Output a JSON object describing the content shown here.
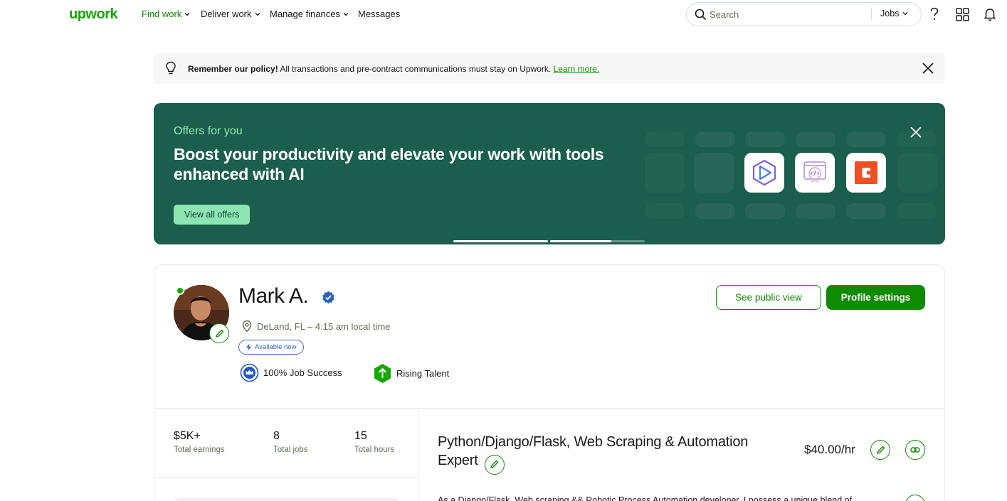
{
  "nav": {
    "logo": "upwork",
    "items": [
      {
        "label": "Find work",
        "active": true,
        "dropdown": true
      },
      {
        "label": "Deliver work",
        "active": false,
        "dropdown": true
      },
      {
        "label": "Manage finances",
        "active": false,
        "dropdown": true
      },
      {
        "label": "Messages",
        "active": false,
        "dropdown": false
      }
    ],
    "search_placeholder": "Search",
    "search_scope": "Jobs",
    "icons": [
      "search-icon",
      "help-icon",
      "apps-grid-icon",
      "notification-bell-icon"
    ]
  },
  "policy": {
    "bold": "Remember our policy!",
    "text": " All transactions and pre-contract communications must stay on Upwork. ",
    "link": "Learn more."
  },
  "offers": {
    "eyebrow": "Offers for you",
    "headline": "Boost your productivity and elevate your work with tools enhanced with AI",
    "button": "View all offers",
    "app_icons": [
      "hexagon-logo-icon",
      "code-brain-icon",
      "coda-logo-icon"
    ],
    "carousel_pages": 3,
    "carousel_active": 2
  },
  "profile": {
    "name": "Mark A.",
    "verified": true,
    "online": true,
    "location": "DeLand, FL – 4:15 am local time",
    "availability": "Available now",
    "badges": [
      {
        "label": "100% Job Success",
        "icon": "job-success-crown-icon"
      },
      {
        "label": "Rising Talent",
        "icon": "rising-talent-icon"
      }
    ],
    "see_public_view": "See public view",
    "profile_settings": "Profile settings",
    "stats": [
      {
        "value": "$5K+",
        "label": "Total earnings"
      },
      {
        "value": "8",
        "label": "Total jobs"
      },
      {
        "value": "15",
        "label": "Total hours"
      }
    ],
    "title": "Python/Django/Flask, Web Scraping & Automation Expert",
    "rate": "$40.00/hr",
    "overview": "As a Django/Flask, Web scraping && Robotic Process Automation developer, I possess a unique blend of"
  },
  "colors": {
    "brand_green": "#14a800",
    "button_green": "#108a00",
    "banner_bg": "#1b5e4d",
    "banner_accent": "#8de6b2",
    "verified_blue": "#2e5fb8"
  }
}
